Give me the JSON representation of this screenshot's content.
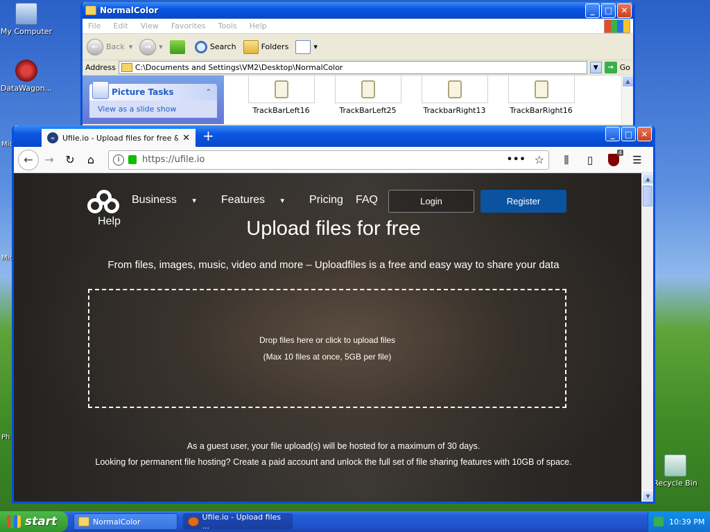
{
  "desktop": {
    "icons": [
      {
        "label": "My Computer"
      },
      {
        "label": "DataWagon..."
      },
      {
        "label": "Recycle Bin"
      }
    ],
    "edge_labels": [
      "Mic",
      "Mic",
      "Ph"
    ]
  },
  "explorer": {
    "title": "NormalColor",
    "menu": [
      "File",
      "Edit",
      "View",
      "Favorites",
      "Tools",
      "Help"
    ],
    "toolbar": {
      "back": "Back",
      "search": "Search",
      "folders": "Folders"
    },
    "address_label": "Address",
    "address_value": "C:\\Documents and Settings\\VM2\\Desktop\\NormalColor",
    "go_label": "Go",
    "tasks_header": "Picture Tasks",
    "task_item": "View as a slide show",
    "thumbnails": [
      "TrackBarLeft16",
      "TrackBarLeft25",
      "TrackbarRight13",
      "TrackBarRight16"
    ]
  },
  "firefox": {
    "tab_title": "Ufile.io - Upload files for free & sh",
    "url": "https://ufile.io",
    "ublock_badge": "4"
  },
  "page": {
    "nav": {
      "business": "Business",
      "features": "Features",
      "pricing": "Pricing",
      "faq": "FAQ",
      "help": "Help"
    },
    "login": "Login",
    "register": "Register",
    "title": "Upload files for free",
    "subtitle": "From files, images, music, video and more – Uploadfiles is a free and easy way to share your data",
    "dropzone_line1": "Drop files here or click to upload files",
    "dropzone_line2": "(Max 10 files at once, 5GB per file)",
    "guest_line1": "As a guest user, your file upload(s) will be hosted for a maximum of 30 days.",
    "guest_line2": "Looking for permanent file hosting? Create a paid account and unlock the full set of file sharing features with 10GB of space."
  },
  "taskbar": {
    "start": "start",
    "tasks": [
      "NormalColor",
      "Ufile.io - Upload files ..."
    ],
    "clock": "10:39 PM"
  }
}
